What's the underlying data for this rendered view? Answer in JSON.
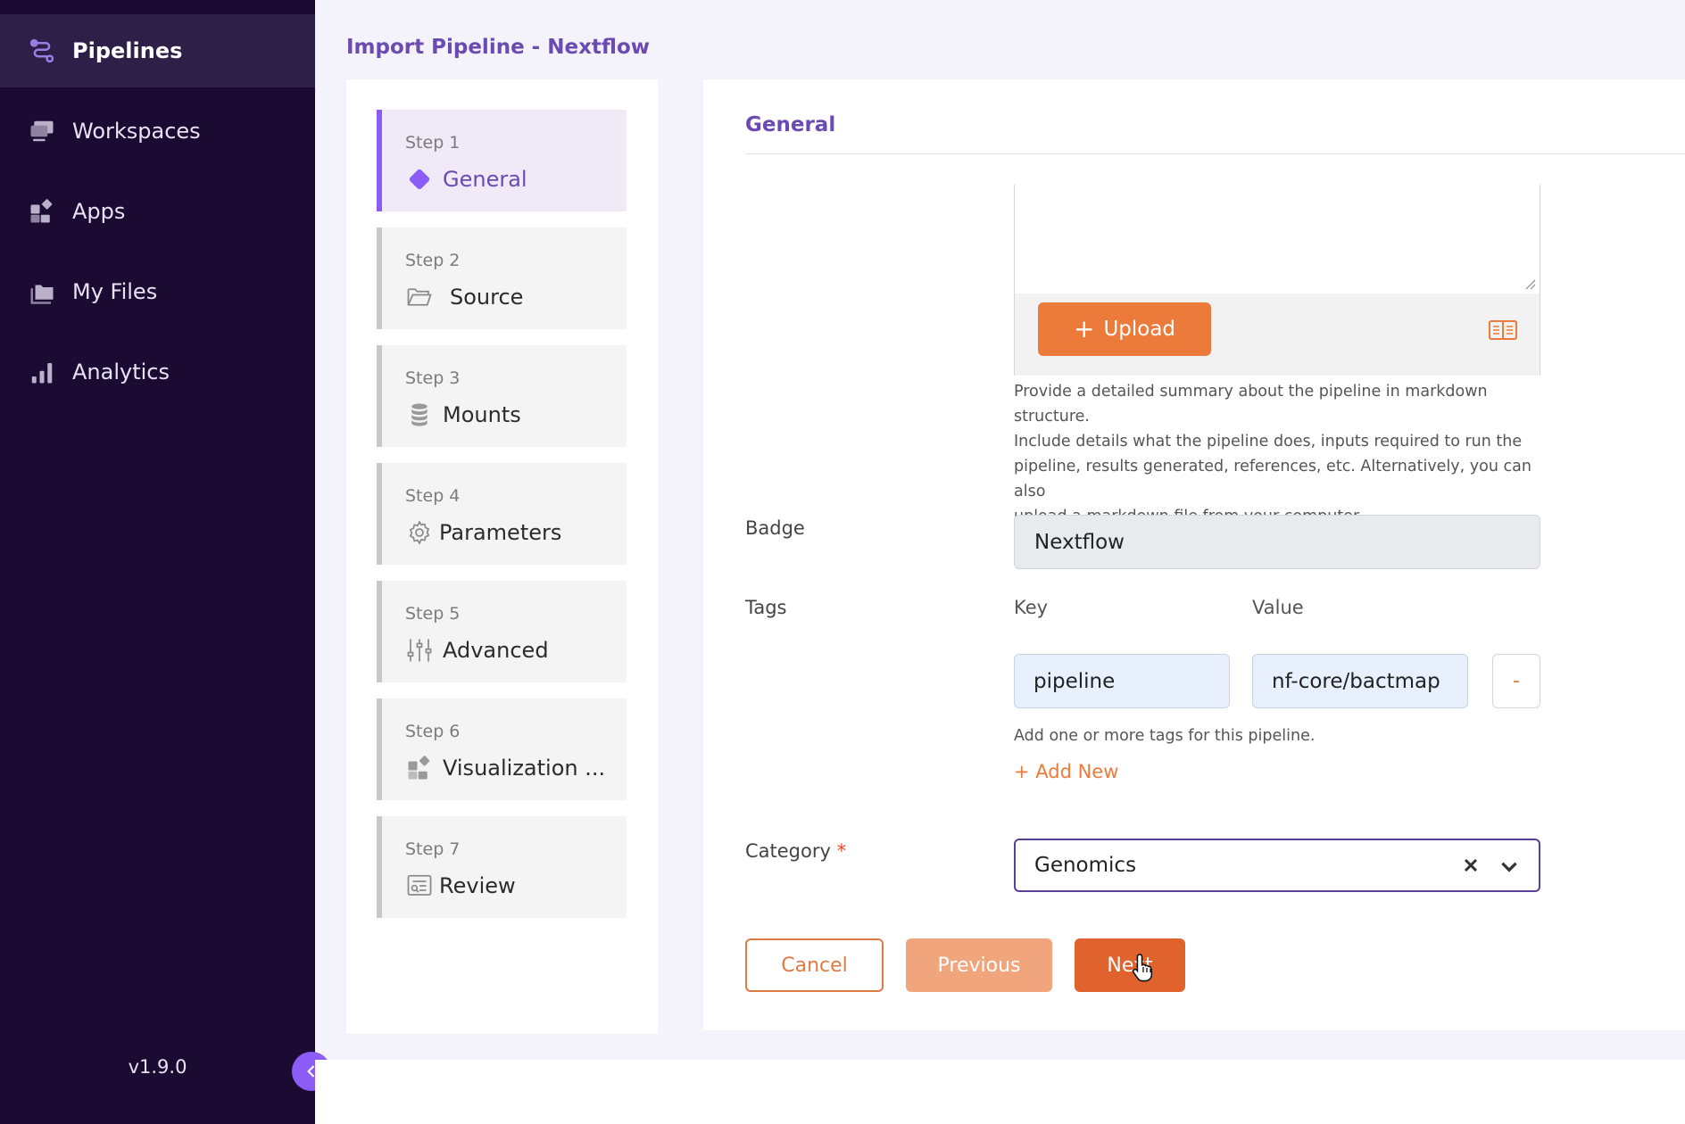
{
  "sidebar": {
    "items": [
      {
        "label": "Pipelines",
        "icon": "pipelines-icon",
        "active": true
      },
      {
        "label": "Workspaces",
        "icon": "workspaces-icon",
        "active": false
      },
      {
        "label": "Apps",
        "icon": "apps-icon",
        "active": false
      },
      {
        "label": "My Files",
        "icon": "files-icon",
        "active": false
      },
      {
        "label": "Analytics",
        "icon": "analytics-icon",
        "active": false
      }
    ],
    "version": "v1.9.0"
  },
  "page": {
    "title": "Import Pipeline - Nextflow"
  },
  "steps": [
    {
      "num": "Step 1",
      "label": "General",
      "icon": "diamond-icon",
      "active": true
    },
    {
      "num": "Step 2",
      "label": "Source",
      "icon": "folder-icon",
      "active": false
    },
    {
      "num": "Step 3",
      "label": "Mounts",
      "icon": "database-icon",
      "active": false
    },
    {
      "num": "Step 4",
      "label": "Parameters",
      "icon": "gear-icon",
      "active": false
    },
    {
      "num": "Step 5",
      "label": "Advanced",
      "icon": "sliders-icon",
      "active": false
    },
    {
      "num": "Step 6",
      "label": "Visualization ...",
      "icon": "apps-icon",
      "active": false
    },
    {
      "num": "Step 7",
      "label": "Review",
      "icon": "review-icon",
      "active": false
    }
  ],
  "form": {
    "section_title": "General",
    "description": {
      "upload_label": "Upload",
      "help_lines": [
        "Provide a detailed summary about the pipeline in markdown structure.",
        "Include details what the pipeline does, inputs required to run the",
        "pipeline, results generated, references, etc. Alternatively, you can also",
        "upload a markdown file from your computer."
      ]
    },
    "badge": {
      "label": "Badge",
      "value": "Nextflow"
    },
    "tags": {
      "label": "Tags",
      "key_header": "Key",
      "value_header": "Value",
      "rows": [
        {
          "key": "pipeline",
          "value": "nf-core/bactmap"
        }
      ],
      "remove_label": "-",
      "help": "Add one or more tags for this pipeline.",
      "add_new_label": "+ Add New"
    },
    "category": {
      "label": "Category",
      "required_mark": "*",
      "value": "Genomics"
    },
    "buttons": {
      "cancel": "Cancel",
      "previous": "Previous",
      "next": "Next"
    }
  },
  "colors": {
    "accent": "#8b5cf6",
    "primary_orange": "#e0622c",
    "sidebar_bg": "#1b0b33"
  }
}
